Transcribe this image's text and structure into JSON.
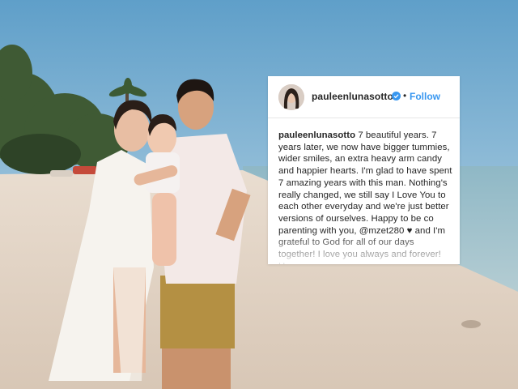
{
  "post": {
    "username": "pauleenlunasotto",
    "follow_label": "Follow",
    "separator": "•",
    "caption_user": "pauleenlunasotto",
    "caption_text": " 7 beautiful years. 7 years later, we now have bigger tummies, wider smiles, an extra heavy arm candy and happier hearts. I'm glad to have spent 7 amazing years with this man. Nothing's really changed, we still say I Love You to each other everyday and we're just better versions of ourselves. Happy to be co parenting with you, @mzet280 ♥ and I'm grateful to God for all of our days together! I love you always and forever! Happy"
  },
  "colors": {
    "follow": "#3897f0",
    "verified_badge": "#3897f0"
  },
  "icons": [
    "verified-badge-icon"
  ]
}
